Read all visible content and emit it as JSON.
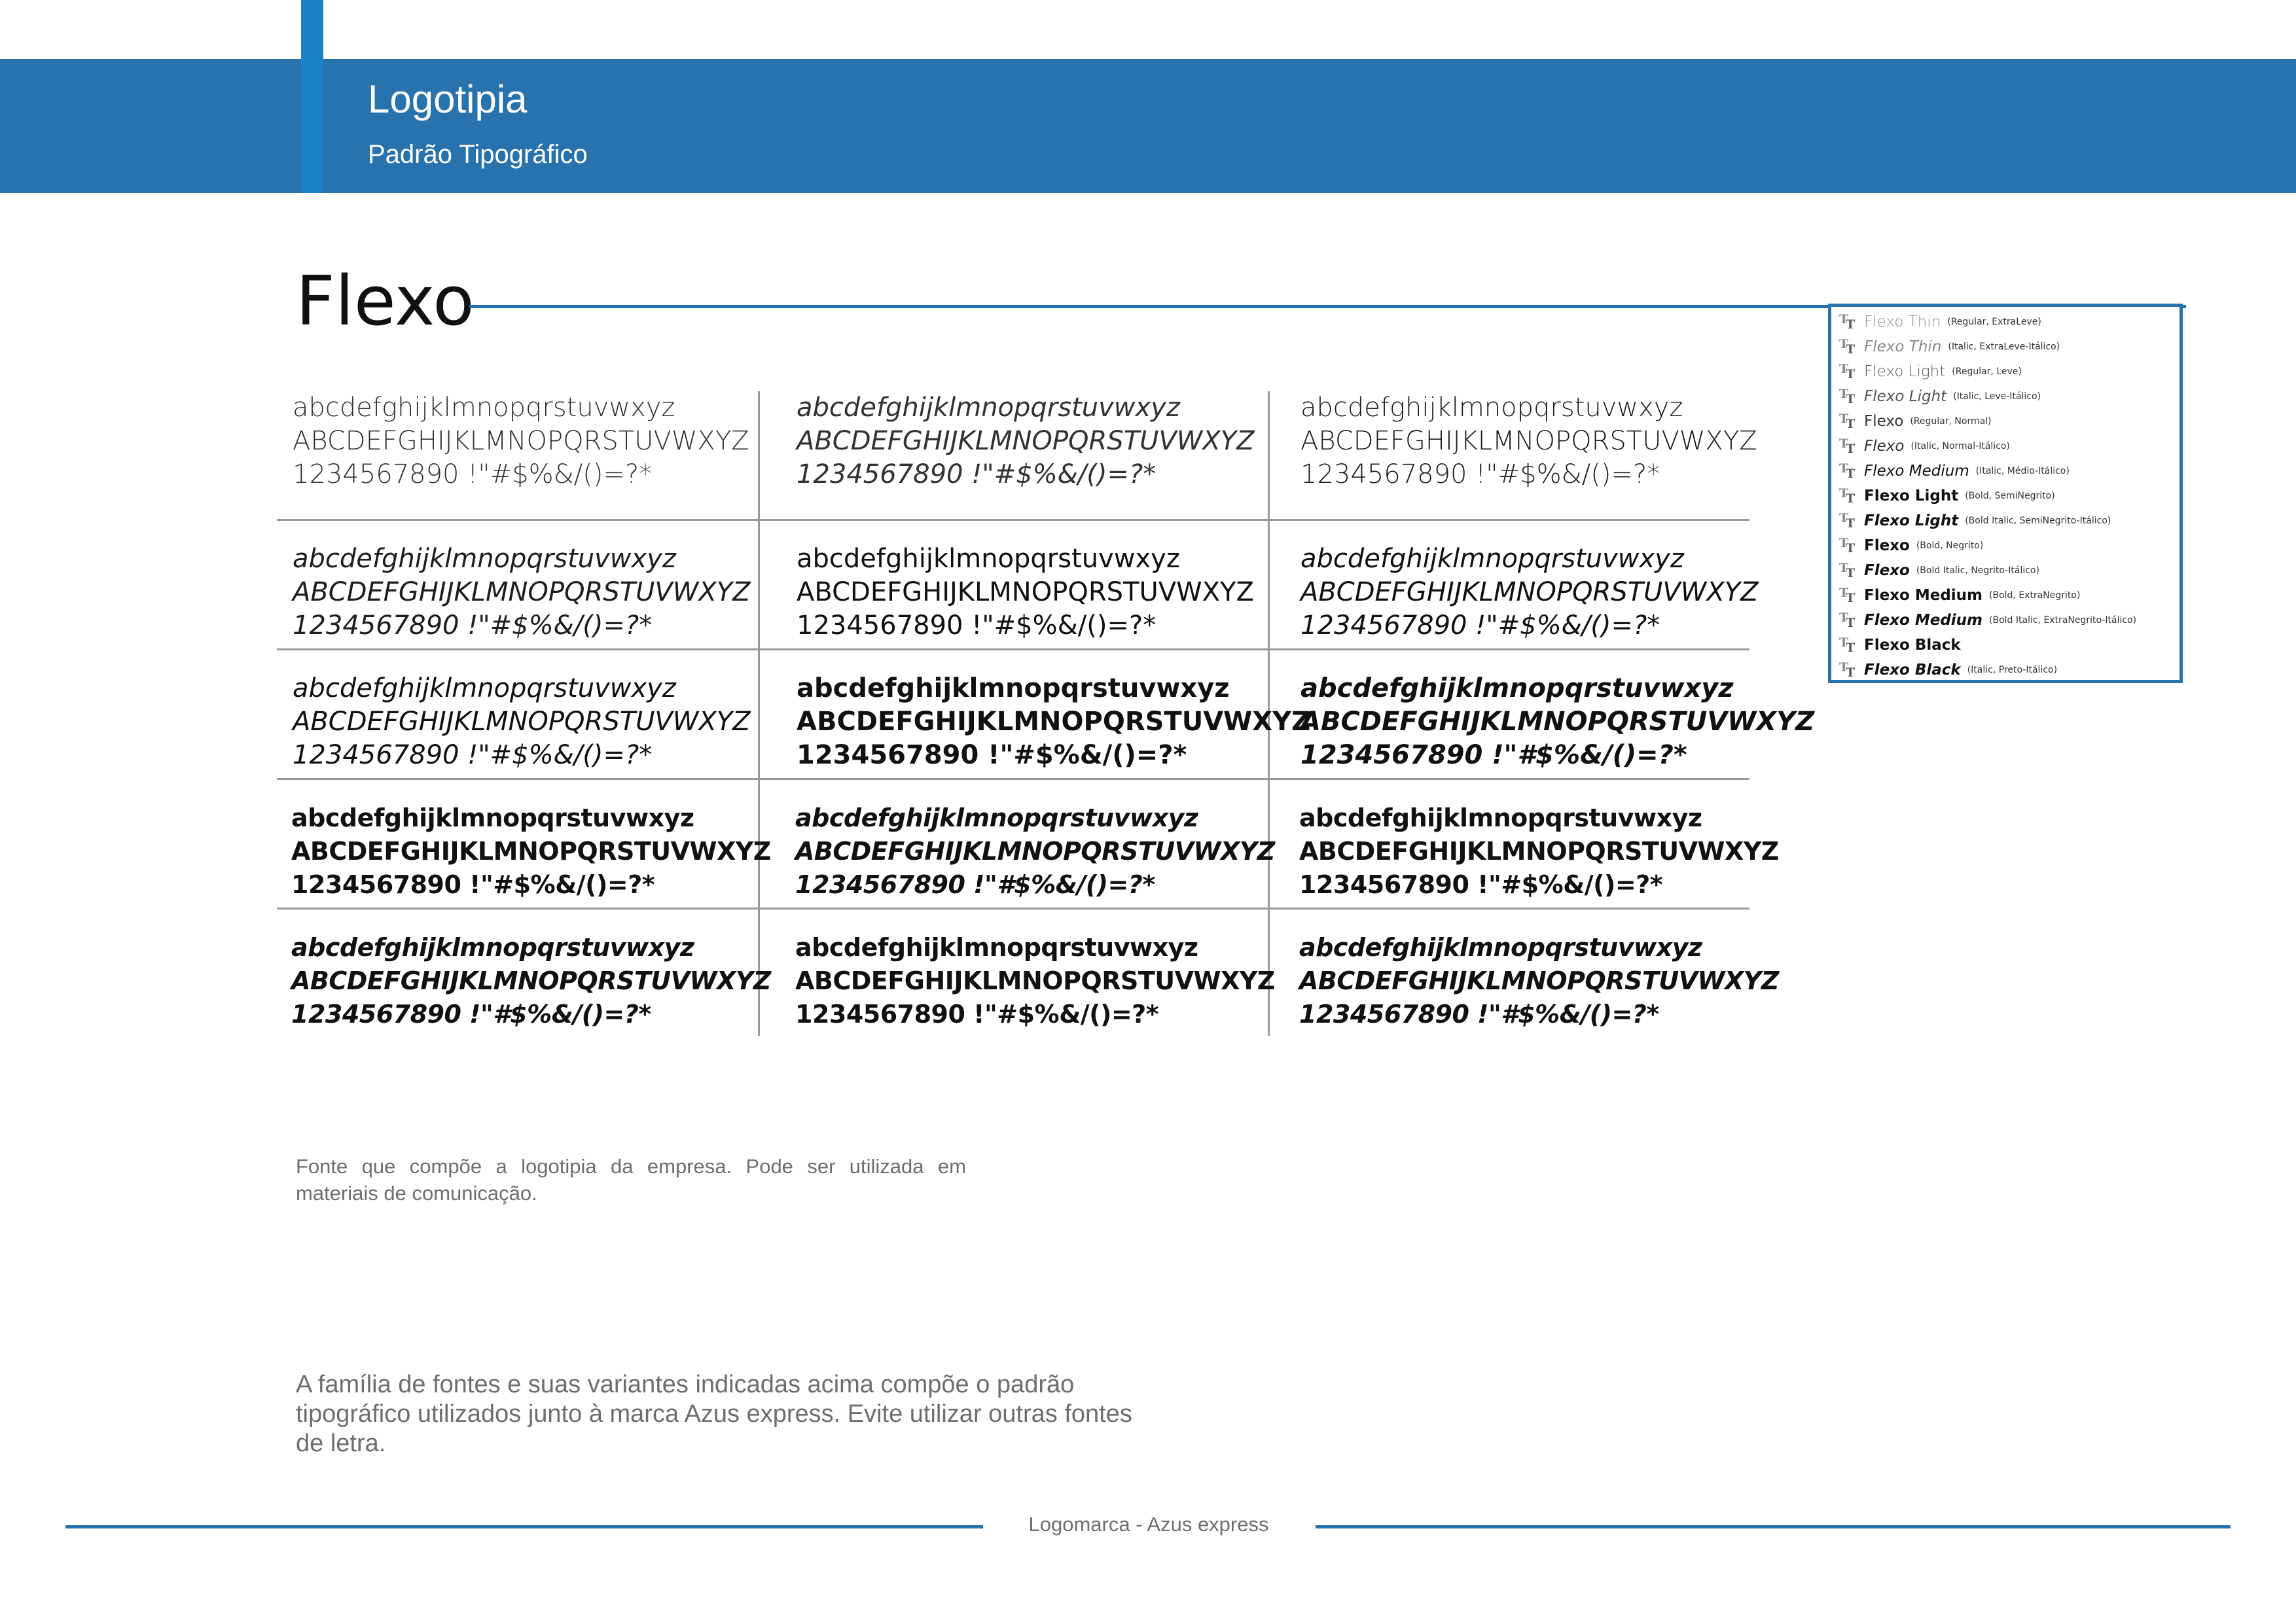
{
  "header": {
    "title": "Logotipia",
    "subtitle": "Padrão Tipográfico"
  },
  "font_family": "Flexo",
  "specimen": {
    "lowercase": "abcdefghijklmnopqrstuvwxyz",
    "uppercase": "ABCDEFGHIJKLMNOPQRSTUVWXYZ",
    "digits": "1234567890 !\"#$%&/()=?*",
    "rows": [
      [
        {
          "weight": "thin",
          "italic": false
        },
        {
          "weight": "thin",
          "italic": true
        },
        {
          "weight": "light",
          "italic": false
        }
      ],
      [
        {
          "weight": "light",
          "italic": true
        },
        {
          "weight": "regular",
          "italic": false
        },
        {
          "weight": "regular",
          "italic": true
        }
      ],
      [
        {
          "weight": "medium",
          "italic": true
        },
        {
          "weight": "semibold",
          "italic": false
        },
        {
          "weight": "semibold",
          "italic": true
        }
      ],
      [
        {
          "weight": "bold",
          "italic": false
        },
        {
          "weight": "bold",
          "italic": true
        },
        {
          "weight": "bold-extra",
          "italic": false
        }
      ],
      [
        {
          "weight": "bold-extra",
          "italic": true
        },
        {
          "weight": "black",
          "italic": false
        },
        {
          "weight": "black",
          "italic": true
        }
      ]
    ]
  },
  "font_list": [
    {
      "name": "Flexo Thin",
      "desc": "(Regular, ExtraLeve)"
    },
    {
      "name": "Flexo Thin",
      "desc": "(Italic, ExtraLeve-Itálico)"
    },
    {
      "name": "Flexo Light",
      "desc": "(Regular, Leve)"
    },
    {
      "name": "Flexo Light",
      "desc": "(Italic, Leve-Itálico)"
    },
    {
      "name": "Flexo",
      "desc": "(Regular, Normal)"
    },
    {
      "name": "Flexo",
      "desc": "(Italic, Normal-Itálico)"
    },
    {
      "name": "Flexo Medium",
      "desc": "(Italic, Médio-Itálico)"
    },
    {
      "name": "Flexo Light",
      "desc": "(Bold, SemiNegrito)"
    },
    {
      "name": "Flexo Light",
      "desc": "(Bold Italic, SemiNegrito-Itálico)"
    },
    {
      "name": "Flexo",
      "desc": "(Bold, Negrito)"
    },
    {
      "name": "Flexo",
      "desc": "(Bold Italic, Negrito-Itálico)"
    },
    {
      "name": "Flexo Medium",
      "desc": "(Bold, ExtraNegrito)"
    },
    {
      "name": "Flexo Medium",
      "desc": "(Bold Italic, ExtraNegrito-Itálico)"
    },
    {
      "name": "Flexo Black",
      "desc": ""
    },
    {
      "name": "Flexo Black",
      "desc": "(Italic, Preto-Itálico)"
    }
  ],
  "notes": {
    "small": "Fonte que compõe a logotipia da empresa. Pode ser utilizada em materiais de comunicação.",
    "large": "A família de fontes e suas variantes indicadas acima compõe o padrão tipográfico utilizados junto à marca Azus express. Evite utilizar outras fontes de letra."
  },
  "footer": {
    "text": "Logomarca - Azus express"
  },
  "colors": {
    "brand_blue": "#2872ad",
    "accent_blue": "#1c80c6",
    "text_gray": "#6e6e6e",
    "grid_gray": "#9a9a9a"
  }
}
